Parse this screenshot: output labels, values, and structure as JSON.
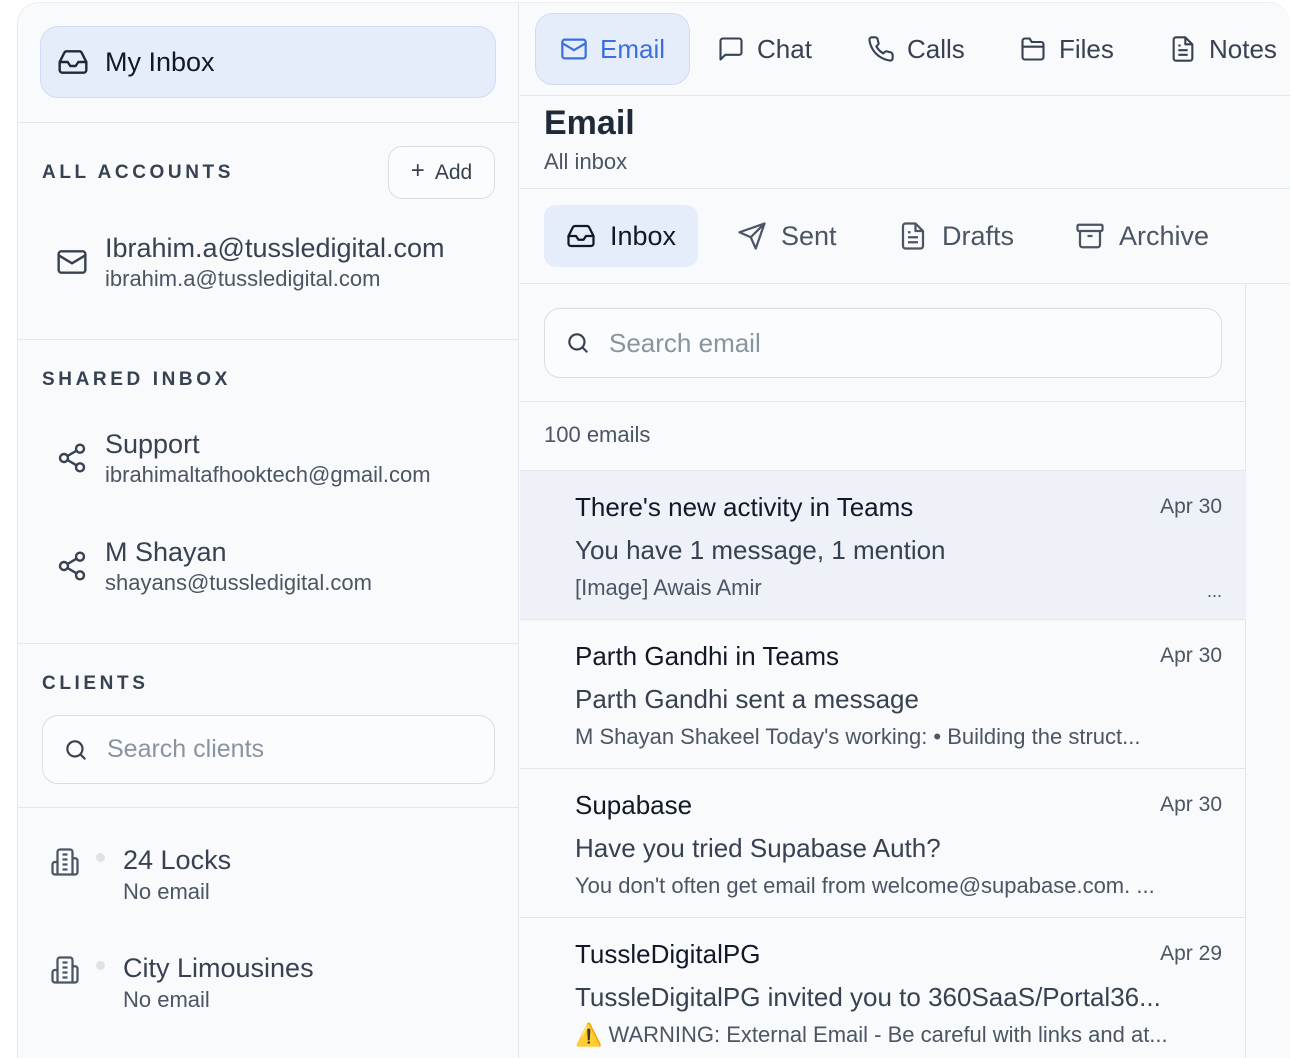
{
  "sidebar": {
    "my_inbox": "My Inbox",
    "all_accounts": {
      "title": "ALL ACCOUNTS",
      "add_label": "Add",
      "items": [
        {
          "name": "Ibrahim.a@tussledigital.com",
          "email": "ibrahim.a@tussledigital.com",
          "icon": "mail-icon"
        }
      ]
    },
    "shared_inbox": {
      "title": "SHARED INBOX",
      "items": [
        {
          "name": "Support",
          "email": "ibrahimaltafhooktech@gmail.com",
          "icon": "share-icon"
        },
        {
          "name": "M Shayan",
          "email": "shayans@tussledigital.com",
          "icon": "share-icon"
        }
      ]
    },
    "clients": {
      "title": "CLIENTS",
      "search_placeholder": "Search clients",
      "items": [
        {
          "name": "24 Locks",
          "email": "No email",
          "icon": "building-icon"
        },
        {
          "name": "City Limousines",
          "email": "No email",
          "icon": "building-icon"
        }
      ]
    }
  },
  "topnav": {
    "tabs": [
      {
        "label": "Email",
        "icon": "mail-icon",
        "active": true
      },
      {
        "label": "Chat",
        "icon": "chat-icon"
      },
      {
        "label": "Calls",
        "icon": "phone-icon"
      },
      {
        "label": "Files",
        "icon": "folder-icon"
      },
      {
        "label": "Notes",
        "icon": "note-icon"
      }
    ]
  },
  "page": {
    "title": "Email",
    "subtitle": "All inbox"
  },
  "subtabs": [
    {
      "label": "Inbox",
      "icon": "inbox-icon",
      "active": true
    },
    {
      "label": "Sent",
      "icon": "send-icon"
    },
    {
      "label": "Drafts",
      "icon": "draft-icon"
    },
    {
      "label": "Archive",
      "icon": "archive-icon"
    }
  ],
  "search": {
    "placeholder": "Search email"
  },
  "email_count": "100 emails",
  "emails": [
    {
      "from": "There's new activity in Teams",
      "date": "Apr 30",
      "subject": "You have 1 message, 1 mention",
      "preview": "[Image] Awais Amir",
      "more": "...",
      "selected": true
    },
    {
      "from": "Parth Gandhi in Teams",
      "date": "Apr 30",
      "subject": "Parth Gandhi sent a message",
      "preview": "M Shayan Shakeel Today's working: • Building the struct..."
    },
    {
      "from": "Supabase",
      "date": "Apr 30",
      "subject": "Have you tried Supabase Auth?",
      "preview": "You don't often get email from welcome@supabase.com. ..."
    },
    {
      "from": "TussleDigitalPG",
      "date": "Apr 29",
      "subject": "TussleDigitalPG invited you to 360SaaS/Portal36...",
      "preview": "⚠️ WARNING: External Email - Be careful with links and at..."
    }
  ],
  "colors": {
    "accent": "#3b6fe0",
    "active_bg": "#e5edfb",
    "selected_row": "#eef2f8"
  }
}
